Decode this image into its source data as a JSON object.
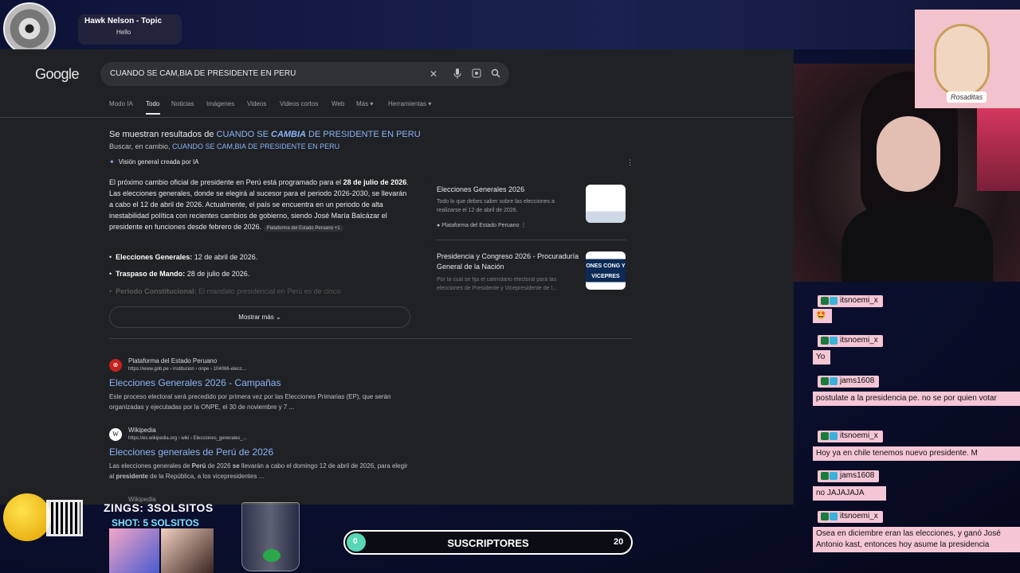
{
  "stream": {
    "music_title": "Hawk Nelson - Topic",
    "music_sub": "Hello",
    "zings": "ZINGS: 3SOLSITOS",
    "shot": "SHOT: 5 SOLSITOS",
    "subs_label": "SUSCRIPTORES",
    "subs_min": "0",
    "subs_max": "20",
    "subs_progress": 0,
    "avatar_label": "Rosaditas"
  },
  "google": {
    "logo": "Google",
    "query": "CUANDO SE CAM,BIA DE PRESIDENTE EN PERU",
    "tabs": [
      "Modo IA",
      "Todo",
      "Noticias",
      "Imágenes",
      "Videos",
      "Videos cortos",
      "Web",
      "Más ▾",
      "Herramientas ▾"
    ],
    "active_tab": "Todo",
    "correction": {
      "prefix": "Se muestran resultados de ",
      "link_a": "CUANDO SE ",
      "link_b": "CAMBIA",
      "link_c": " DE PRESIDENTE EN PERU",
      "instead_prefix": "Buscar, en cambio, ",
      "instead_link": "CUANDO SE CAM,BIA DE PRESIDENTE EN PERU"
    },
    "ai_overview": {
      "header": "Visión general creada por IA",
      "p1": "El próximo cambio oficial de presidente en Perú está programado para el ",
      "p1_bold": "28 de julio de 2026",
      "p2": ". Las elecciones generales, donde se elegirá al sucesor para el periodo 2026-2030, se llevarán a cabo el 12 de abril de 2026. Actualmente, el país se encuentra en un periodo de alta inestabilidad política con recientes cambios de gobierno, siendo José María Balcázar el presidente en funciones desde febrero de 2026.",
      "source_chip": "Plataforma del Estado Peruano +1",
      "bullets": [
        {
          "bold": "Elecciones Generales:",
          "text": " 12 de abril de 2026."
        },
        {
          "bold": "Traspaso de Mando:",
          "text": " 28 de julio de 2026."
        },
        {
          "bold": "Periodo Constitucional:",
          "text": " El mandato presidencial en Perú es de cinco"
        }
      ],
      "show_more": "Mostrar más"
    },
    "cards": [
      {
        "title": "Elecciones Generales 2026",
        "desc": "Todo lo que debes saber sobre las elecciones a realizarse el 12 de abril de 2026.",
        "source": "Plataforma del Estado Peruano"
      },
      {
        "title": "Presidencia y Congreso 2026 - Procuraduría General de la Nación",
        "desc": "Por la cual se fija el calendario electoral para las elecciones de Presidente y Vicepresidente de l...",
        "thumb_text": "ONES CONG Y VICEPRES"
      }
    ],
    "results": [
      {
        "site": "Plataforma del Estado Peruano",
        "url": "https://www.gob.pe › institucion › onpe › 104066-elecc...",
        "title": "Elecciones Generales 2026 - Campañas",
        "snippet": "Este proceso electoral será precedido por primera vez por las Elecciones Primarias (EP), que serán organizadas y ejecutadas por la ONPE, el 30 de noviembre y 7 ..."
      },
      {
        "site": "Wikipedia",
        "url": "https://es.wikipedia.org › wiki › Elecciones_generales_...",
        "title": "Elecciones generales de Perú de 2026",
        "snippet_a": "Las elecciones generales de ",
        "snippet_b": "Perú",
        "snippet_c": " de 2026 ",
        "snippet_d": "se",
        "snippet_e": " llevarán a cabo el domingo 12 de abril de 2026, para elegir al ",
        "snippet_f": "presidente",
        "snippet_g": " de la República, a los vicepresidentes ..."
      },
      {
        "site": "Wikipedia"
      }
    ]
  },
  "chat": [
    {
      "user": "itsnoemi_x",
      "msg": "🤩"
    },
    {
      "user": "itsnoemi_x",
      "msg": "Yo"
    },
    {
      "user": "jams1608",
      "msg": "postulate a la presidencia pe. no se por quien votar"
    },
    {
      "user": "itsnoemi_x",
      "msg": "Hoy ya en chile tenemos nuevo presidente. M"
    },
    {
      "user": "jams1608",
      "msg": "no JAJAJAJA"
    },
    {
      "user": "itsnoemi_x",
      "msg": "Osea en diciembre eran las elecciones, y ganó José Antonio kast, entonces hoy asume la presidencia"
    }
  ],
  "colors": {
    "accent_link": "#8ab4f8",
    "chat_bg": "#f5c6d6",
    "progress": "#59d6b5"
  }
}
